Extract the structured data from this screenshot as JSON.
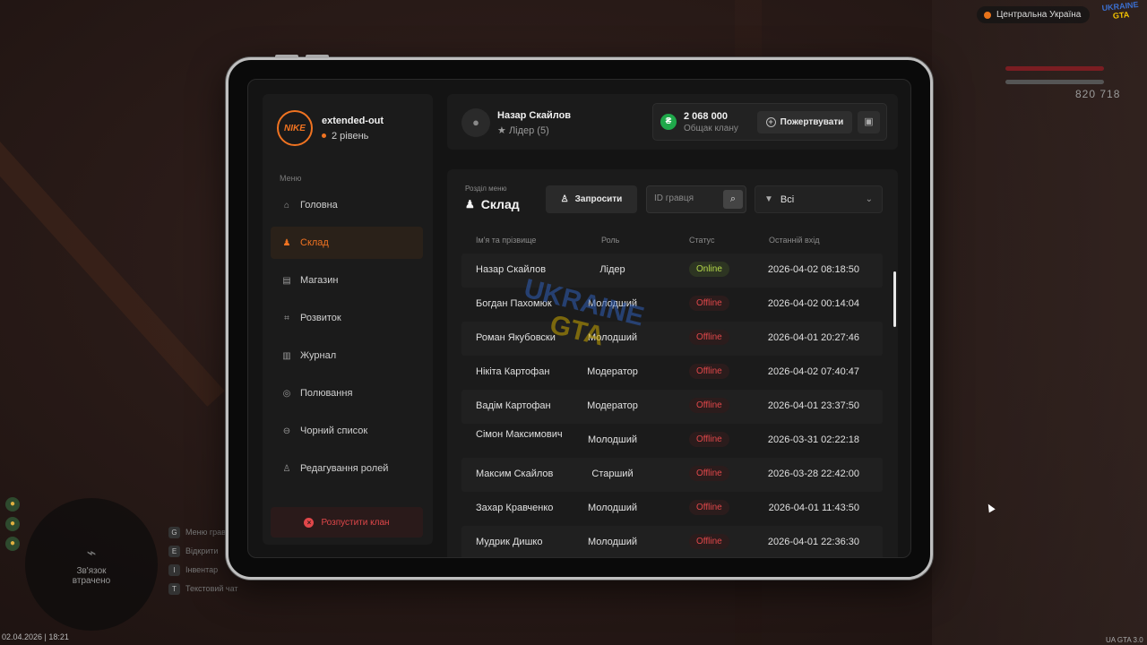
{
  "hud": {
    "region": "Центральна Україна",
    "logo_top": "UKRAINE",
    "logo_bottom": "GTA",
    "money": "820 718",
    "minimap_text": "Зв'язок втрачено",
    "hints": [
      {
        "key": "G",
        "label": "Меню гравця"
      },
      {
        "key": "E",
        "label": "Відкрити"
      },
      {
        "key": "I",
        "label": "Інвентар"
      },
      {
        "key": "T",
        "label": "Текстовий чат"
      }
    ],
    "date": "02.04.2026 | 18:21",
    "version": "UA GTA 3.0"
  },
  "sidebar": {
    "clan_name": "extended-out",
    "clan_level": "2 рівень",
    "logo_text": "NIKE",
    "menu_title": "Меню",
    "items": [
      {
        "label": "Головна",
        "icon": "home-icon",
        "glyph": "⌂",
        "active": false
      },
      {
        "label": "Склад",
        "icon": "group-icon",
        "glyph": "♟",
        "active": true
      },
      {
        "label": "Магазин",
        "icon": "shop-icon",
        "glyph": "▤",
        "active": false
      },
      {
        "label": "Розвиток",
        "icon": "chart-icon",
        "glyph": "⌗",
        "active": false
      },
      {
        "label": "Журнал",
        "icon": "book-icon",
        "glyph": "▥",
        "active": false
      },
      {
        "label": "Полювання",
        "icon": "target-icon",
        "glyph": "◎",
        "active": false
      },
      {
        "label": "Чорний список",
        "icon": "block-icon",
        "glyph": "⊖",
        "active": false
      },
      {
        "label": "Редагування ролей",
        "icon": "user-edit-icon",
        "glyph": "♙",
        "active": false
      }
    ],
    "disband_label": "Розпустити клан"
  },
  "header": {
    "user_name": "Назар Скайлов",
    "user_role": "Лідер (5)",
    "bank_amount": "2 068 000",
    "bank_label": "Общак клану",
    "donate_label": "Пожертвувати"
  },
  "main": {
    "section_sub": "Розділ меню",
    "section_title": "Склад",
    "invite_label": "Запросити",
    "search_placeholder": "ID гравця",
    "filter_value": "Всі",
    "columns": [
      "Ім'я та прізвище",
      "Роль",
      "Статус",
      "Останній вхід"
    ],
    "members": [
      {
        "name": "Назар Скайлов",
        "role": "Лідер",
        "status": "Online",
        "last": "2026-04-02 08:18:50"
      },
      {
        "name": "Богдан Пахомюк",
        "role": "Молодший",
        "status": "Offline",
        "last": "2026-04-02 00:14:04"
      },
      {
        "name": "Роман Якубовски",
        "role": "Молодший",
        "status": "Offline",
        "last": "2026-04-01 20:27:46"
      },
      {
        "name": "Нікіта Картофан",
        "role": "Модератор",
        "status": "Offline",
        "last": "2026-04-02 07:40:47"
      },
      {
        "name": "Вадім Картофан",
        "role": "Модератор",
        "status": "Offline",
        "last": "2026-04-01 23:37:50"
      },
      {
        "name": "Сімон Максимович",
        "role": "Молодший",
        "status": "Offline",
        "last": "2026-03-31 02:22:18"
      },
      {
        "name": "Максим Скайлов",
        "role": "Старший",
        "status": "Offline",
        "last": "2026-03-28 22:42:00"
      },
      {
        "name": "Захар Кравченко",
        "role": "Молодший",
        "status": "Offline",
        "last": "2026-04-01 11:43:50"
      },
      {
        "name": "Мудрик Дишко",
        "role": "Молодший",
        "status": "Offline",
        "last": "2026-04-01 22:36:30"
      }
    ]
  },
  "watermark": {
    "line1": "UKRAINE",
    "line2": "GTA"
  },
  "colors": {
    "accent": "#f07321",
    "online": "#b5d94a",
    "offline": "#e0474a",
    "bank": "#1fa84a"
  }
}
